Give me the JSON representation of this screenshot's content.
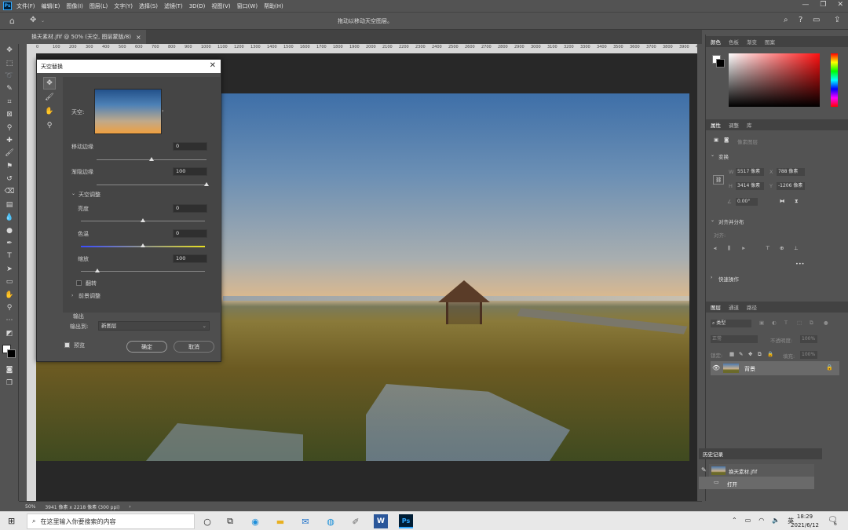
{
  "menubar": {
    "items": [
      "文件(F)",
      "编辑(E)",
      "图像(I)",
      "图层(L)",
      "文字(Y)",
      "选择(S)",
      "滤镜(T)",
      "3D(D)",
      "视图(V)",
      "窗口(W)",
      "帮助(H)"
    ],
    "window_controls": [
      "—",
      "❐",
      "✕"
    ]
  },
  "options_bar": {
    "hint": "拖动以移动天空图层。"
  },
  "document_tab": {
    "title": "换天素材.jfif @ 50% (天空, 图层蒙版/8)",
    "close": "×"
  },
  "ruler_ticks": [
    "0",
    "100",
    "200",
    "300",
    "400",
    "500",
    "600",
    "700",
    "800",
    "900",
    "1000",
    "1100",
    "1200",
    "1300",
    "1400",
    "1500",
    "1600",
    "1700",
    "1800",
    "1900",
    "2000",
    "2100",
    "2200",
    "2300",
    "2400",
    "2500",
    "2600",
    "2700",
    "2800",
    "2900",
    "3000",
    "3100",
    "3200",
    "3300",
    "3400",
    "3500",
    "3600",
    "3700",
    "3800",
    "3900",
    "4000"
  ],
  "statusbar": {
    "zoom": "50%",
    "info": "3941 像素 x 2218 像素 (300 ppi)",
    "arrow": "›"
  },
  "dialog": {
    "title": "天空替换",
    "sky_label": "天空:",
    "shift_edge_label": "移动边缘",
    "shift_edge_value": "0",
    "fade_edge_label": "渐隐边缘",
    "fade_edge_value": "100",
    "sky_adjust_label": "天空调整",
    "brightness_label": "亮度",
    "brightness_value": "0",
    "temperature_label": "色温",
    "temperature_value": "0",
    "scale_label": "缩放",
    "scale_value": "100",
    "flip_label": "翻转",
    "foreground_adjust_label": "前景调整",
    "output_label": "输出",
    "output_to_label": "输出到:",
    "output_to_value": "新图层",
    "preview_label": "预览",
    "ok_label": "确定",
    "cancel_label": "取消",
    "sliders": {
      "shift_edge": 0.5,
      "fade_edge": 1.0,
      "brightness": 0.5,
      "temperature": 0.5,
      "scale": 0.13
    }
  },
  "right_panel": {
    "color_tabs": [
      "颜色",
      "色板",
      "渐变",
      "图案"
    ],
    "props_tabs": [
      "属性",
      "调整",
      "库"
    ],
    "pixel_layer": "像素图层",
    "transform_label": "变换",
    "w_label": "W",
    "w_value": "5517 像素",
    "x_label": "X",
    "x_value": "788 像素",
    "h_label": "H",
    "h_value": "3414 像素",
    "y_label": "Y",
    "y_value": "-1206 像素",
    "angle_value": "0.00°",
    "align_label": "对齐并分布",
    "align_sub": "对齐:",
    "ellipsis": "•••",
    "quick_actions_label": "快速操作",
    "layers_tabs": [
      "图层",
      "通道",
      "路径"
    ],
    "layer_kind": "类型",
    "blend_mode": "正常",
    "opacity_label": "不透明度:",
    "opacity_value": "100%",
    "lock_label": "锁定:",
    "fill_label": "填充:",
    "fill_value": "100%",
    "layer_name": "背景",
    "history_tab": "历史记录",
    "history_file": "换天素材.jfif",
    "history_open": "打开"
  },
  "taskbar": {
    "search_placeholder": "在这里输入你要搜索的内容",
    "time": "18:29",
    "date": "2021/6/12",
    "ime": "英",
    "notifications": "6"
  },
  "colors": {
    "ps_background": "#535353",
    "canvas_background": "#282828",
    "accent_blue": "#31a8ff"
  }
}
